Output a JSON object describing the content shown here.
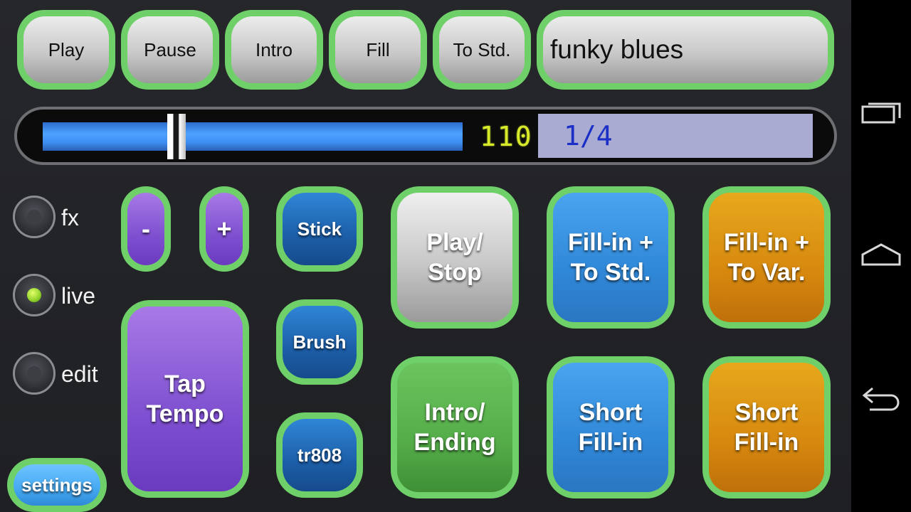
{
  "top_bar": {
    "play_label": "Play",
    "pause_label": "Pause",
    "intro_label": "Intro",
    "fill_label": "Fill",
    "to_std_label": "To Std.",
    "style_name": "funky blues"
  },
  "tempo": {
    "slider_value_fraction": 0.31,
    "bpm": "110",
    "beat_position": "1/4"
  },
  "modes": [
    {
      "label": "fx",
      "selected": false
    },
    {
      "label": "live",
      "selected": true
    },
    {
      "label": "edit",
      "selected": false
    }
  ],
  "tempo_controls": {
    "minus_label": "-",
    "plus_label": "+",
    "tap_tempo_line1": "Tap",
    "tap_tempo_line2": "Tempo"
  },
  "kits": {
    "stick_label": "Stick",
    "brush_label": "Brush",
    "tr808_label": "tr808"
  },
  "pads": {
    "play_stop": [
      "Play/",
      "Stop"
    ],
    "fill_to_std": [
      "Fill-in +",
      "To Std."
    ],
    "fill_to_var": [
      "Fill-in +",
      "To Var."
    ],
    "intro_ending": [
      "Intro/",
      "Ending"
    ],
    "short_fill_std": [
      "Short",
      "Fill-in"
    ],
    "short_fill_var": [
      "Short",
      "Fill-in"
    ]
  },
  "settings_label": "settings",
  "colors": {
    "border_green": "#6fd06a",
    "purple": "#8a5ad6",
    "dark_blue": "#1c5ea8",
    "blue": "#3088d8",
    "orange": "#d7890f",
    "green": "#55ad49",
    "bpm_text": "#d8ea2a",
    "beat_text": "#1b2fc6"
  },
  "navbar": {
    "icons": [
      "recent-apps-icon",
      "home-icon",
      "back-icon"
    ]
  }
}
